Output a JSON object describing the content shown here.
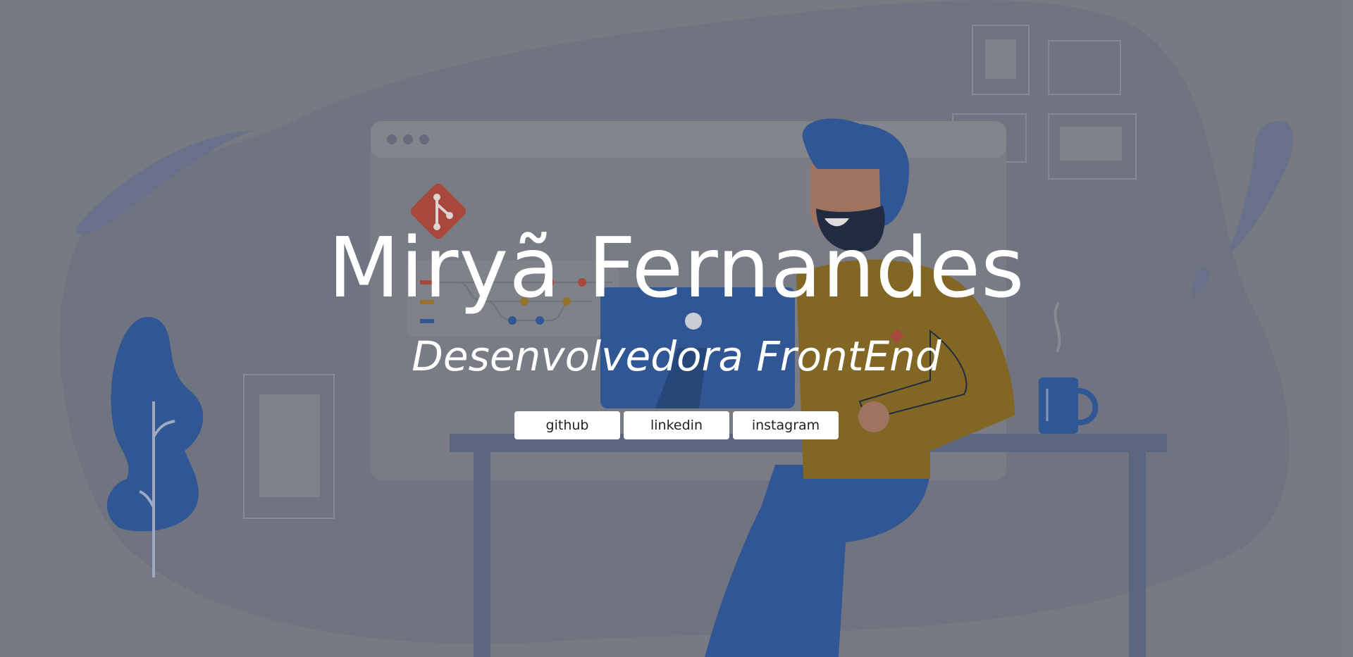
{
  "hero": {
    "title": "Miryã Fernandes",
    "subtitle": "Desenvolvedora FrontEnd"
  },
  "links": [
    {
      "label": "github"
    },
    {
      "label": "linkedin"
    },
    {
      "label": "instagram"
    }
  ],
  "colors": {
    "background": "#7e8188",
    "blob": "#727884",
    "accent_blue": "#2e5a9c",
    "mustard": "#8a6a1f",
    "git_red": "#b4483a",
    "desk": "#5d6a86",
    "button_bg": "#ffffff",
    "text": "#ffffff"
  },
  "illustration": {
    "icons": [
      "git-logo-icon",
      "laptop-icon",
      "mug-icon",
      "plant-icon",
      "developer-figure"
    ]
  }
}
